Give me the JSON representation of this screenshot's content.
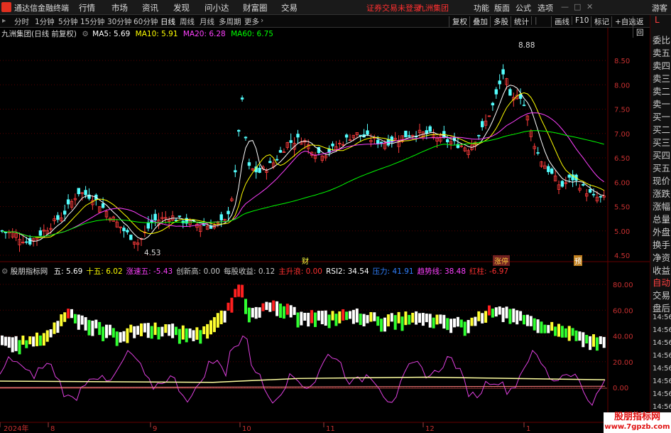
{
  "menubar": {
    "app_title": "通达信金融终端",
    "menu_items": [
      "行情",
      "市场",
      "资讯",
      "发现",
      "问小达",
      "财富圈",
      "交易"
    ],
    "status_text": "证券交易未登录",
    "stock_name": "九洲集团",
    "right_items": [
      "功能",
      "版面",
      "公式",
      "选项"
    ],
    "guest": "游客"
  },
  "periodbar": {
    "periods": [
      "分时",
      "1分钟",
      "5分钟",
      "15分钟",
      "30分钟",
      "60分钟",
      "日线",
      "周线",
      "月线",
      "多周期",
      "更多"
    ],
    "active_period": "日线",
    "tools": [
      "复权",
      "叠加",
      "多股",
      "统计",
      "画线",
      "F10",
      "标记",
      "+自选",
      "返回"
    ]
  },
  "main_chart": {
    "title": "九洲集团(日线 前复权)",
    "ma_labels": [
      "MA5: 5.69",
      "MA10: 5.91",
      "MA20: 6.28",
      "MA60: 6.75"
    ],
    "ma_colors": [
      "#ffffff",
      "#ffff00",
      "#ff40ff",
      "#00ff00"
    ],
    "high_label": "8.88",
    "low_label": "4.53",
    "price_ticks": [
      "8.50",
      "8.00",
      "7.50",
      "7.00",
      "6.50",
      "6.00",
      "5.50",
      "5.00",
      "4.50"
    ],
    "markers": [
      "财",
      "涨停",
      "预"
    ]
  },
  "indicator": {
    "title": "股朋指标网",
    "values": [
      {
        "text": "五: 5.69",
        "color": "#ffffff"
      },
      {
        "text": "十五: 6.02",
        "color": "#ffff00"
      },
      {
        "text": "涨速五: -5.43",
        "color": "#ff40ff"
      },
      {
        "text": "创新高: 0.00",
        "color": "#c8c8c8"
      },
      {
        "text": "每股收益: 0.12",
        "color": "#c8c8c8"
      },
      {
        "text": "主升浪: 0.00",
        "color": "#ff3030"
      },
      {
        "text": "RSI2: 34.54",
        "color": "#ffffff"
      },
      {
        "text": "压力: 41.91",
        "color": "#3080ff"
      },
      {
        "text": "趋势线: 38.48",
        "color": "#ff40ff"
      },
      {
        "text": "红柱: -6.97",
        "color": "#ff3030"
      }
    ],
    "ticks": [
      "80.00",
      "60.00",
      "40.00",
      "20.00",
      "0.00"
    ]
  },
  "time_axis": [
    "2024年",
    "8",
    "9",
    "10",
    "11",
    "12",
    "1"
  ],
  "right_panel": {
    "top_label": "L",
    "labels": [
      "委比",
      "卖五",
      "卖四",
      "卖三",
      "卖二",
      "卖一",
      "买一",
      "买二",
      "买三",
      "买四",
      "买五",
      "现价",
      "涨跌",
      "涨幅",
      "总量",
      "外盘",
      "换手",
      "净资",
      "收益"
    ],
    "tab_labels": [
      "自动",
      "交易",
      "盘后"
    ],
    "times": [
      "14:56",
      "14:56",
      "14:56",
      "14:56",
      "14:56",
      "14:56",
      "14:56",
      "14:56"
    ]
  },
  "watermark": {
    "line1": "股朋指标网",
    "line2": "www.7gpzb.com"
  }
}
